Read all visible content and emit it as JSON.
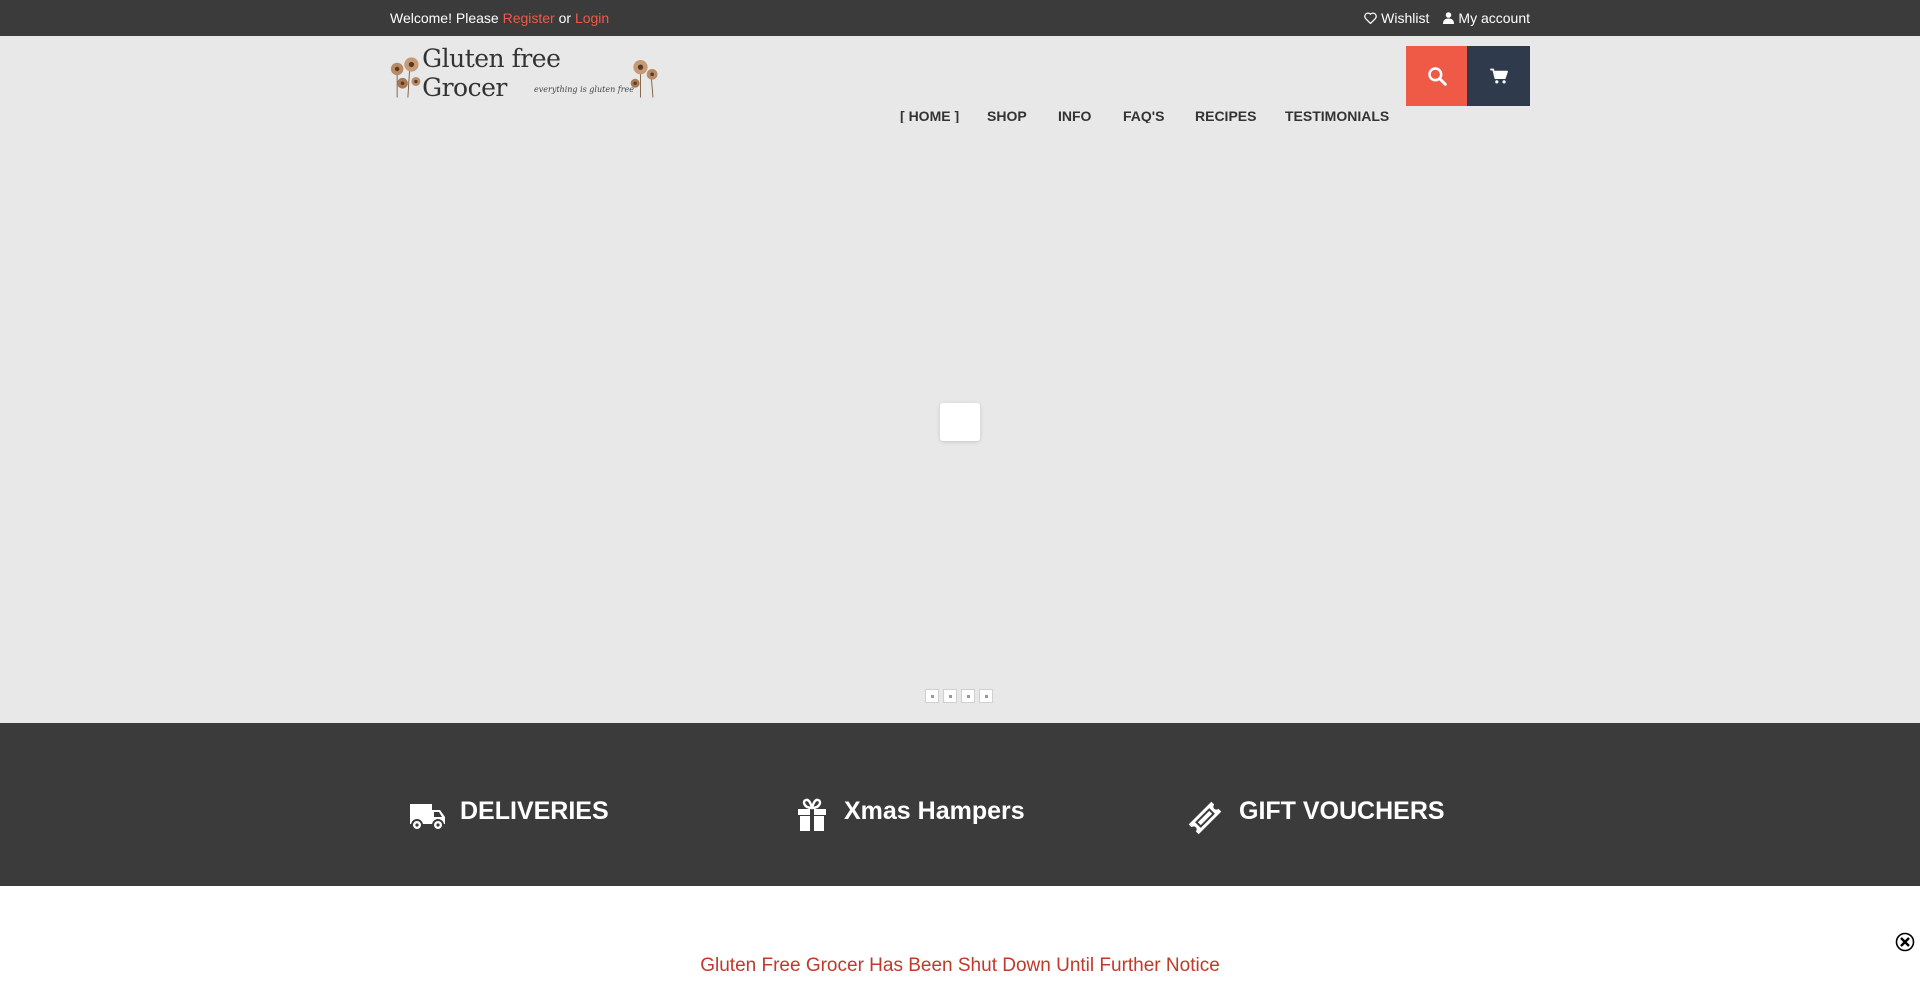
{
  "topbar": {
    "welcome_prefix": "Welcome! Please",
    "register_label": "Register",
    "or_label": "or",
    "login_label": "Login",
    "wishlist_label": "Wishlist",
    "account_label": "My account"
  },
  "header": {
    "logo_name": "Gluten free Grocer",
    "logo_tagline": "everything is gluten free",
    "nav": [
      {
        "label": "HOME",
        "active": true
      },
      {
        "label": "SHOP"
      },
      {
        "label": "INFO"
      },
      {
        "label": "FAQ'S"
      },
      {
        "label": "RECIPES"
      },
      {
        "label": "TESTIMONIALS"
      }
    ]
  },
  "hero": {
    "slide_count": 4
  },
  "features": [
    {
      "icon": "truck-icon",
      "title": "DELIVERIES"
    },
    {
      "icon": "gift-icon",
      "title": "Xmas Hampers"
    },
    {
      "icon": "ticket-icon",
      "title": "GIFT VOUCHERS"
    }
  ],
  "notice": {
    "text": "Gluten Free Grocer Has Been Shut Down Until Further Notice"
  },
  "colors": {
    "topbar_bg": "#3b3b3b",
    "accent": "#ef5a47",
    "cart_bg": "#2f3b4c",
    "hero_bg": "#e8e8e8",
    "notice_text": "#c0392b"
  }
}
